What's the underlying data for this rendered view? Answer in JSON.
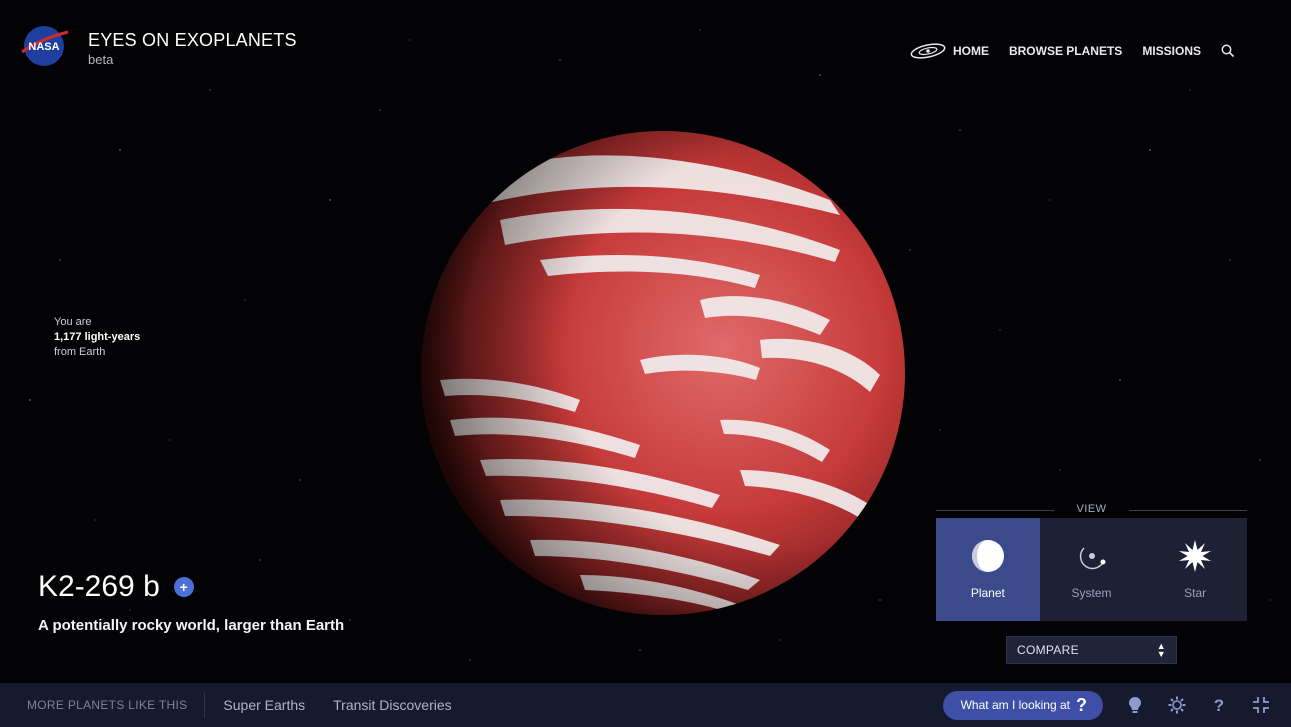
{
  "header": {
    "title": "EYES ON EXOPLANETS",
    "subtitle": "beta",
    "logo_icon": "nasa-logo",
    "nav": [
      {
        "label": "HOME",
        "icon": "galaxy-icon"
      },
      {
        "label": "BROWSE PLANETS"
      },
      {
        "label": "MISSIONS"
      }
    ],
    "search_icon": "search-icon"
  },
  "distance": {
    "line1": "You are",
    "line2": "1,177 light-years",
    "line3": "from Earth"
  },
  "planet": {
    "name": "K2-269 b",
    "description": "A potentially rocky world, larger than Earth",
    "info_icon": "+"
  },
  "view": {
    "label": "VIEW",
    "options": [
      {
        "label": "Planet",
        "icon": "planet-icon",
        "active": true
      },
      {
        "label": "System",
        "icon": "system-icon",
        "active": false
      },
      {
        "label": "Star",
        "icon": "star-icon",
        "active": false
      }
    ],
    "compare_label": "COMPARE"
  },
  "bottom": {
    "more_label": "MORE PLANETS LIKE THIS",
    "links": [
      "Super Earths",
      "Transit Discoveries"
    ],
    "looking_label": "What am I looking at",
    "looking_q": "?",
    "tools": [
      "lightbulb-icon",
      "settings-icon",
      "help-icon",
      "fullscreen-icon"
    ]
  },
  "colors": {
    "accent": "#3f4fa8",
    "active_view": "#3a4a8a",
    "bar": "#151a2c",
    "planet_red": "#c63a3a"
  }
}
